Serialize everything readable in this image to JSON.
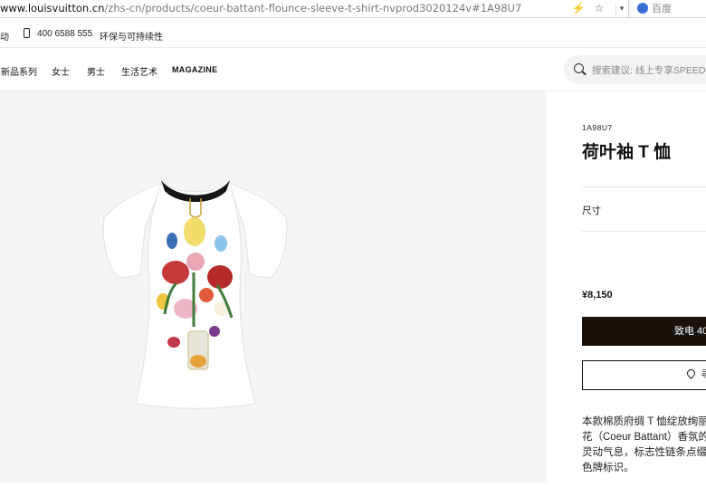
{
  "browser": {
    "url_domain": "www.louisvuitton.cn",
    "url_path": "/zhs-cn/products/coeur-battant-flounce-sleeve-t-shirt-nvprod3020124v#1A98U7",
    "search_engine_placeholder": "百度",
    "icons": [
      "lightning-icon",
      "star-icon",
      "dropdown-icon",
      "baidu-paw-icon"
    ]
  },
  "utility_bar": {
    "cut_left_text": "动",
    "phone": "400 6588 555",
    "sustainability": "环保与可持续性"
  },
  "nav": {
    "items": [
      "新品系列",
      "女士",
      "男士",
      "生活艺术",
      "MAGAZINE"
    ],
    "search_placeholder": "搜索建议: 线上专享SPEEDY"
  },
  "product": {
    "sku": "1A98U7",
    "title": "荷叶袖 T 恤",
    "size_label": "尺寸",
    "price": "¥8,150",
    "call_button": "致电 400",
    "store_button": "寻",
    "description": "本款棉质府绸 T 恤绽放绚丽花（Coeur Battant）香氛的灵动气息，标志性链条点缀撞色牌标识。"
  },
  "colors": {
    "dark_button": "#19110b",
    "gallery_bg": "#f6f5f3"
  }
}
